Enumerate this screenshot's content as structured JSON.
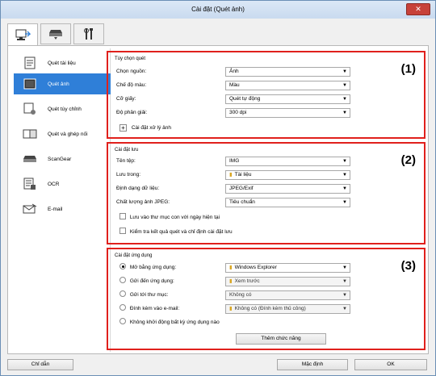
{
  "window": {
    "title": "Cài đặt (Quét ảnh)",
    "close_glyph": "✕"
  },
  "tabs": [
    {
      "icon": "scan-pc-icon"
    },
    {
      "icon": "scanner-icon"
    },
    {
      "icon": "tools-icon"
    }
  ],
  "nav": {
    "items": [
      {
        "label": "Quét tài liệu",
        "icon": "document-icon"
      },
      {
        "label": "Quét ảnh",
        "icon": "photo-icon"
      },
      {
        "label": "Quét tùy chỉnh",
        "icon": "custom-scan-icon"
      },
      {
        "label": "Quét và ghép nối",
        "icon": "stitch-icon"
      },
      {
        "label": "ScanGear",
        "icon": "scangear-icon"
      },
      {
        "label": "OCR",
        "icon": "ocr-icon"
      },
      {
        "label": "E-mail",
        "icon": "email-icon"
      }
    ]
  },
  "scan_options": {
    "title": "Tùy chọn quét",
    "number": "(1)",
    "select_source_label": "Chọn nguồn:",
    "select_source_value": "Ảnh",
    "color_mode_label": "Chế độ màu:",
    "color_mode_value": "Màu",
    "paper_size_label": "Cỡ giấy:",
    "paper_size_value": "Quét tự động",
    "resolution_label": "Độ phân giải:",
    "resolution_value": "300 dpi",
    "image_processing_label": "Cài đặt xử lý ảnh"
  },
  "save_settings": {
    "title": "Cài đặt lưu",
    "number": "(2)",
    "file_name_label": "Tên tệp:",
    "file_name_value": "IMG",
    "save_in_label": "Lưu trong:",
    "save_in_value": "Tài liệu",
    "data_format_label": "Định dạng dữ liệu:",
    "data_format_value": "JPEG/Exif",
    "jpeg_quality_label": "Chất lượng ảnh JPEG:",
    "jpeg_quality_value": "Tiêu chuẩn",
    "subfolder_label": "Lưu vào thư mục con với ngày hiện tại",
    "check_results_label": "Kiểm tra kết quả quét và chỉ định cài đặt lưu"
  },
  "app_settings": {
    "title": "Cài đặt ứng dụng",
    "number": "(3)",
    "open_with_label": "Mở bằng ứng dụng:",
    "open_with_value": "Windows Explorer",
    "send_to_app_label": "Gửi đến ứng dụng:",
    "send_to_app_value": "Xem trước",
    "send_to_folder_label": "Gửi tới thư mục:",
    "send_to_folder_value": "Không có",
    "attach_email_label": "Đính kèm vào e-mail:",
    "attach_email_value": "Không có (Đính kèm thủ công)",
    "no_app_label": "Không khởi động bất kỳ ứng dụng nào",
    "more_functions_label": "Thêm chức năng"
  },
  "footer": {
    "instructions_label": "Chỉ dẫn",
    "defaults_label": "Mặc định",
    "ok_label": "OK"
  },
  "colors": {
    "accent": "#2f7fd8",
    "highlight_box": "#e0201c"
  }
}
